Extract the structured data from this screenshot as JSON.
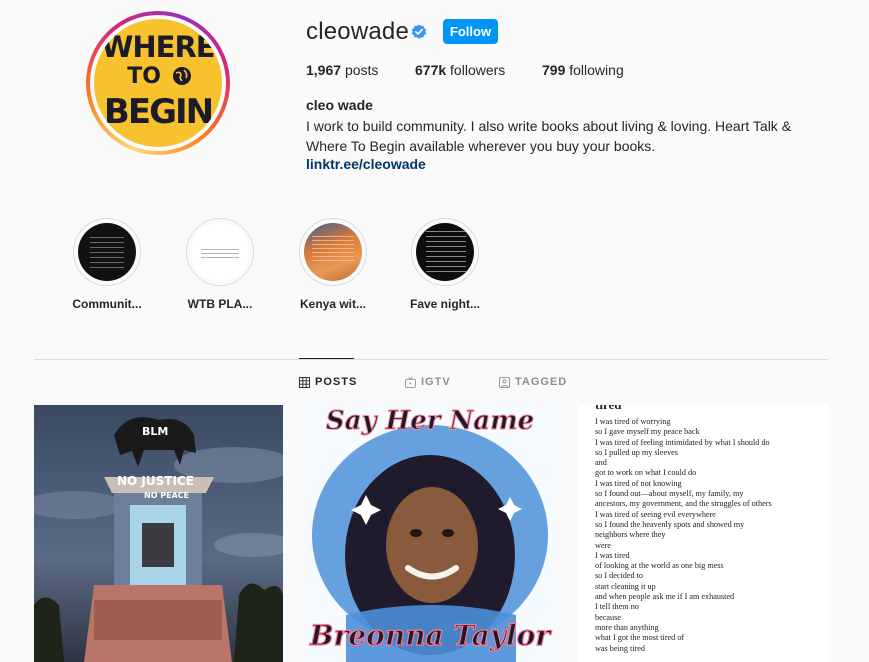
{
  "profile": {
    "username": "cleowade",
    "follow_label": "Follow",
    "avatar_words": [
      "WHERE",
      "TO",
      "BEGIN"
    ],
    "stats": {
      "posts_count": "1,967",
      "posts_label": "posts",
      "followers_count": "677k",
      "followers_label": "followers",
      "following_count": "799",
      "following_label": "following"
    },
    "full_name": "cleo wade",
    "bio_line1": "I work to build community. I also write books about living & loving. Heart Talk &",
    "bio_line2": "Where To Begin available wherever you buy your books.",
    "link": "linktr.ee/cleowade"
  },
  "highlights": [
    {
      "label": "Communit..."
    },
    {
      "label": "WTB PLA..."
    },
    {
      "label": "Kenya wit..."
    },
    {
      "label": "Fave night..."
    }
  ],
  "tabs": [
    {
      "label": "POSTS",
      "icon": "grid-icon",
      "active": true
    },
    {
      "label": "IGTV",
      "icon": "igtv-icon",
      "active": false
    },
    {
      "label": "TAGGED",
      "icon": "tagged-icon",
      "active": false
    }
  ],
  "posts": {
    "post1": {
      "monument_text_1": "BLM",
      "monument_text_2": "NO JUSTICE",
      "monument_text_3": "NO PEACE"
    },
    "post2": {
      "top_text": "Say Her Name",
      "bottom_text": "Breonna Taylor"
    },
    "post3": {
      "title": "tired",
      "lines": [
        "I was tired of worrying",
        "so I gave myself my peace back",
        "I was tired of feeling intimidated by what I should do",
        "so I pulled up my sleeves",
        "and",
        "got to work on what I could do",
        "I was tired of not knowing",
        "so I found out—about myself, my family, my",
        "ancestors, my government, and the struggles of others",
        "I was tired of seeing evil everywhere",
        "so I found the heavenly spots and showed my",
        "neighbors where they",
        "were",
        "I was tired",
        "of looking at the world as one big mess",
        "so I decided to",
        "start cleaning it up",
        "and when people ask me if I am exhausted",
        "I tell them no",
        "because",
        "more than anything",
        "what I got the most tired of",
        "was being tired"
      ]
    }
  },
  "colors": {
    "follow_button": "#0095f6",
    "verified_badge": "#3897f0",
    "link": "#00376b",
    "avatar_bg": "#f7c22e"
  }
}
